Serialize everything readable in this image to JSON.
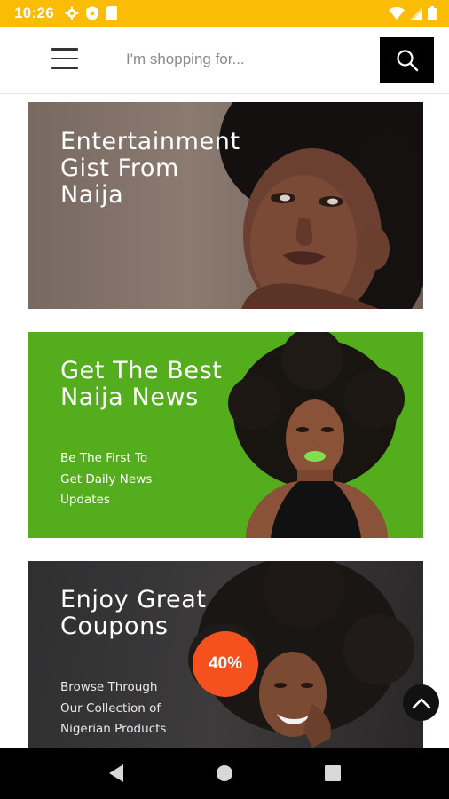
{
  "status_bar": {
    "time": "10:26",
    "icons_left": [
      "gear-icon",
      "shield-icon",
      "sd-card-icon"
    ],
    "icons_right": [
      "wifi-icon",
      "signal-icon",
      "battery-icon"
    ],
    "background_color": "#fbbc05"
  },
  "header": {
    "menu_icon": "hamburger-menu-icon",
    "search": {
      "placeholder": "I'm shopping for...",
      "value": ""
    },
    "search_icon": "search-icon"
  },
  "banners": [
    {
      "title_lines": [
        "Entertainment",
        "Gist From",
        "Naija"
      ],
      "background_color": "#7d6d64"
    },
    {
      "title_lines": [
        "Get The Best",
        "Naija News"
      ],
      "subtitle_lines": [
        "Be The First To",
        "Get Daily News",
        "Updates"
      ],
      "background_color": "#54ad1c"
    },
    {
      "title_lines": [
        "Enjoy Great",
        "Coupons"
      ],
      "badge": "40%",
      "subtitle_lines": [
        "Browse Through",
        "Our Collection of",
        "Nigerian Products"
      ],
      "background_color": "#333132",
      "badge_color": "#f4511e"
    }
  ],
  "scroll_top_icon": "chevron-up-icon",
  "nav_bar": {
    "buttons": [
      "back-icon",
      "home-icon",
      "recents-icon"
    ]
  }
}
